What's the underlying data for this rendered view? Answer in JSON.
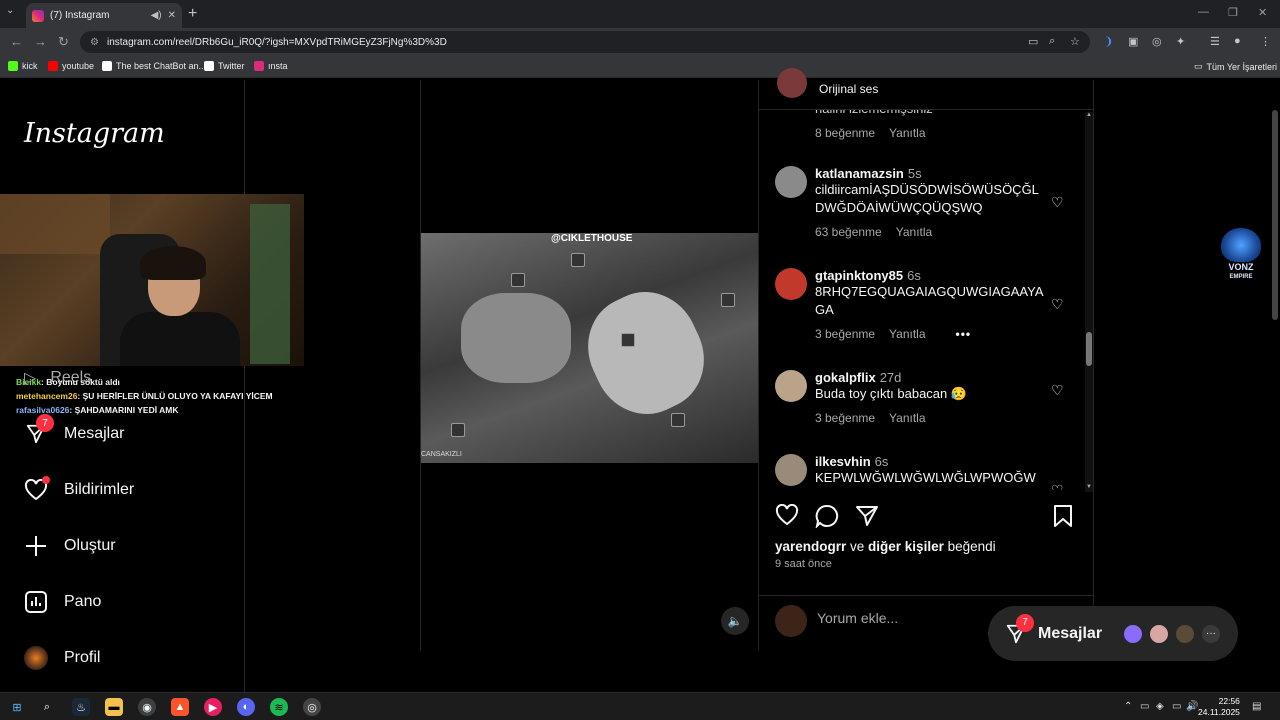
{
  "browser": {
    "tab_title": "(7) Instagram",
    "url": "instagram.com/reel/DRb6Gu_iR0Q/?igsh=MXVpdTRiMGEyZ3FjNg%3D%3D",
    "bookmarks": [
      {
        "label": "kick",
        "color": "#53fc18"
      },
      {
        "label": "youtube",
        "color": "#ff0000"
      },
      {
        "label": "The best ChatBot an...",
        "color": "#ffffff"
      },
      {
        "label": "Twitter",
        "color": "#ffffff"
      },
      {
        "label": "ınsta",
        "color": "#dd2a7b"
      }
    ],
    "all_bookmarks": "Tüm Yer İşaretleri"
  },
  "sidebar": {
    "logo": "Instagram",
    "reels_label": "Reels",
    "items": [
      {
        "label": "Mesajlar",
        "icon": "messenger-icon",
        "badge": "7"
      },
      {
        "label": "Bildirimler",
        "icon": "heart-icon"
      },
      {
        "label": "Oluştur",
        "icon": "plus-icon"
      },
      {
        "label": "Pano",
        "icon": "dashboard-icon"
      },
      {
        "label": "Profil",
        "icon": "avatar"
      }
    ]
  },
  "stream_chat": [
    {
      "user": "Bicikk",
      "msg": ": Boyunu söktü aldı"
    },
    {
      "user": "metehancem26",
      "msg": ": ŞU HERİFLER ÜNLÜ OLUYO YA KAFAYI YİCEM"
    },
    {
      "user": "rafasilva0626",
      "msg": ": ŞAHDAMARINI YEDİ AMK"
    }
  ],
  "video": {
    "watermark": "@CIKLETHOUSE",
    "caption": "CANSAKIZLI"
  },
  "panel": {
    "audio_label": "Orijinal ses",
    "partial_comment": "halini izlememişsiniz",
    "partial_likes": "8 beğenme",
    "reply_label": "Yanıtla",
    "comments": [
      {
        "user": "katlanamazsin",
        "time": "5s",
        "text": "cildiircamİAŞDÜSÖDWİSÖWÜSÖÇĞLDWĞDÖAİWÜWÇQÜQŞWQ",
        "likes": "63 beğenme",
        "avatar_color": "#8a8a8a"
      },
      {
        "user": "gtapinktony85",
        "time": "6s",
        "text": "8RHQ7EGQUAGAIAGQUWGIAGAAYAGA",
        "likes": "3 beğenme",
        "avatar_color": "#c0392b",
        "more": "•••"
      },
      {
        "user": "gokalpflix",
        "time": "27d",
        "text": "Buda toy çıktı babacan 😥",
        "likes": "3 beğenme",
        "avatar_color": "#b9a48a"
      },
      {
        "user": "ilkesvhin",
        "time": "6s",
        "text": "KEPWLWĞWLWĞWLWĞLWPWOĞW",
        "likes": "",
        "avatar_color": "#9a8a7a"
      }
    ],
    "liked_by_user": "yarendogrr",
    "liked_by_and": " ve ",
    "liked_by_others": "diğer kişiler",
    "liked_by_suffix": " beğendi",
    "time_ago": "9 saat önce",
    "comment_placeholder": "Yorum ekle..."
  },
  "messages_pill": {
    "label": "Mesajlar",
    "badge": "7",
    "more": "···"
  },
  "overlay_logo": {
    "line1": "VONZ",
    "line2": "EMPIRE"
  },
  "taskbar": {
    "time": "22:56",
    "date": "24.11.2025"
  }
}
